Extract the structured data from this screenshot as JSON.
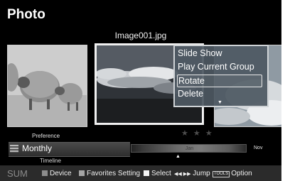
{
  "header": {
    "title": "Photo"
  },
  "current_file": "Image001.jpg",
  "context_menu": {
    "items": [
      {
        "label": "Slide Show"
      },
      {
        "label": "Play Current Group"
      },
      {
        "label": "Rotate"
      },
      {
        "label": "Delete"
      }
    ],
    "more": "▼",
    "selected_index": 2
  },
  "rating": "★ ★ ★",
  "sort": {
    "preference_label": "Preference",
    "view_label": "Monthly",
    "timeline_label": "Timeline"
  },
  "timeline_bar": {
    "current": "Jan",
    "next": "Nov",
    "pointer": "▲"
  },
  "footer": {
    "sum_label": "SUM",
    "device_label": "Device",
    "favorites_label": "Favorites Setting",
    "select_label": "Select",
    "jump_arrows": "◀◀ ▶▶",
    "jump_label": "Jump",
    "tools_label": "TOOLS",
    "option_label": "Option"
  }
}
